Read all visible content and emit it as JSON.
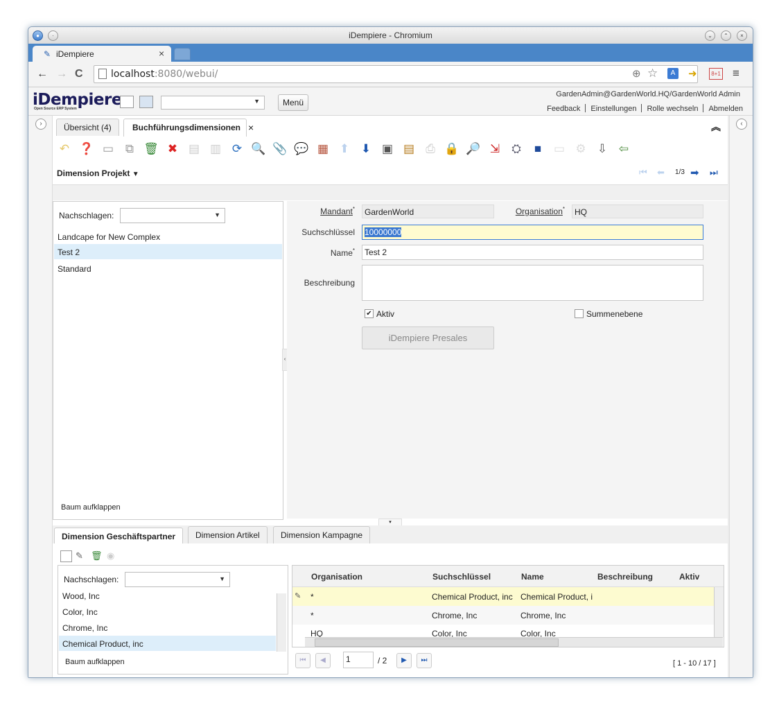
{
  "browser": {
    "window_title": "iDempiere - Chromium",
    "tab_title": "iDempiere",
    "url_host": "localhost",
    "url_rest": ":8080/webui/"
  },
  "header": {
    "logo": "iDempiere",
    "logo_sub": "Open Source ERP System",
    "menu_label": "Menü",
    "user": "GardenAdmin@GardenWorld.HQ/GardenWorld Admin",
    "links": [
      "Feedback",
      "Einstellungen",
      "Rolle wechseln",
      "Abmelden"
    ]
  },
  "window_tabs": [
    {
      "label": "Übersicht (4)"
    },
    {
      "label": "Buchführungsdimensionen"
    }
  ],
  "toolbar": {
    "record_title": "Dimension Projekt",
    "record_nav": "1/3"
  },
  "tree": {
    "search_label": "Nachschlagen:",
    "items": [
      "Landcape for New Complex",
      "Test 2",
      "Standard"
    ],
    "expand_label": "Baum aufklappen"
  },
  "form": {
    "client_label": "Mandant",
    "client_value": "GardenWorld",
    "org_label": "Organisation",
    "org_value": "HQ",
    "key_label": "Suchschlüssel",
    "key_value": "10000000",
    "name_label": "Name",
    "name_value": "Test 2",
    "desc_label": "Beschreibung",
    "desc_value": "",
    "active_label": "Aktiv",
    "summary_label": "Summenebene",
    "presales_button": "iDempiere Presales"
  },
  "detail": {
    "tabs": [
      "Dimension Geschäftspartner",
      "Dimension Artikel",
      "Dimension Kampagne"
    ],
    "tree_search_label": "Nachschlagen:",
    "tree_items": [
      "Wood, Inc",
      "Color, Inc",
      "Chrome, Inc",
      "Chemical Product, inc"
    ],
    "tree_expand_label": "Baum aufklappen",
    "columns": [
      "Organisation",
      "Suchschlüssel",
      "Name",
      "Beschreibung",
      "Aktiv"
    ],
    "rows": [
      {
        "org": "*",
        "key": "Chemical Product, inc",
        "name": "Chemical Product, i",
        "desc": ""
      },
      {
        "org": "*",
        "key": "Chrome, Inc",
        "name": "Chrome, Inc",
        "desc": ""
      },
      {
        "org": "HQ",
        "key": "Color, Inc",
        "name": "Color, Inc",
        "desc": ""
      }
    ],
    "page_value": "1",
    "page_total": "/ 2",
    "page_info": "[ 1 - 10 / 17 ]"
  }
}
